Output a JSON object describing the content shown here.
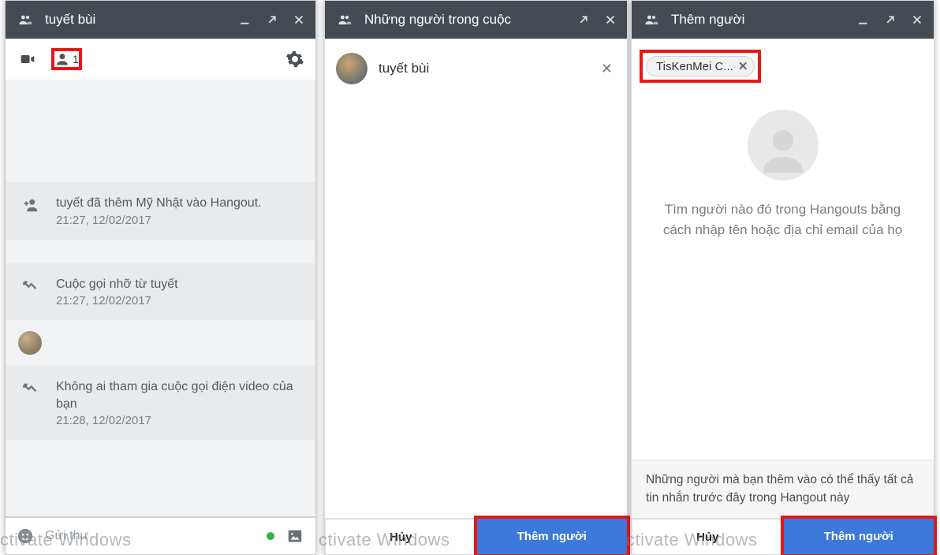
{
  "panel1": {
    "title": "tuyết bùi",
    "people_count": "1",
    "messages": [
      {
        "icon": "add-user",
        "line1": "tuyết đã thêm Mỹ Nhật vào Hangout.",
        "line2": "21:27, 12/02/2017"
      },
      {
        "icon": "missed",
        "line1": "Cuộc gọi nhỡ từ tuyết",
        "line2": "21:27, 12/02/2017"
      },
      {
        "icon": "avatar",
        "line1": "",
        "line2": ""
      },
      {
        "icon": "missed",
        "line1": "Không ai tham gia cuộc gọi điện video của bạn",
        "line2": "21:28, 12/02/2017"
      }
    ],
    "compose_placeholder": "Gửi thư"
  },
  "panel2": {
    "title": "Những người trong cuộc",
    "search_name": "tuyết bùi",
    "cancel": "Hủy",
    "add": "Thêm người"
  },
  "panel3": {
    "title": "Thêm người",
    "chip": "TisKenMei C...",
    "placeholder_text": "Tìm người nào đó trong Hangouts bằng cách nhập tên hoặc địa chỉ email của họ",
    "info": "Những người mà bạn thêm vào có thể thấy tất cả tin nhắn trước đây trong Hangout này",
    "cancel": "Hủy",
    "add": "Thêm người"
  },
  "watermark": "ctivate Windows"
}
